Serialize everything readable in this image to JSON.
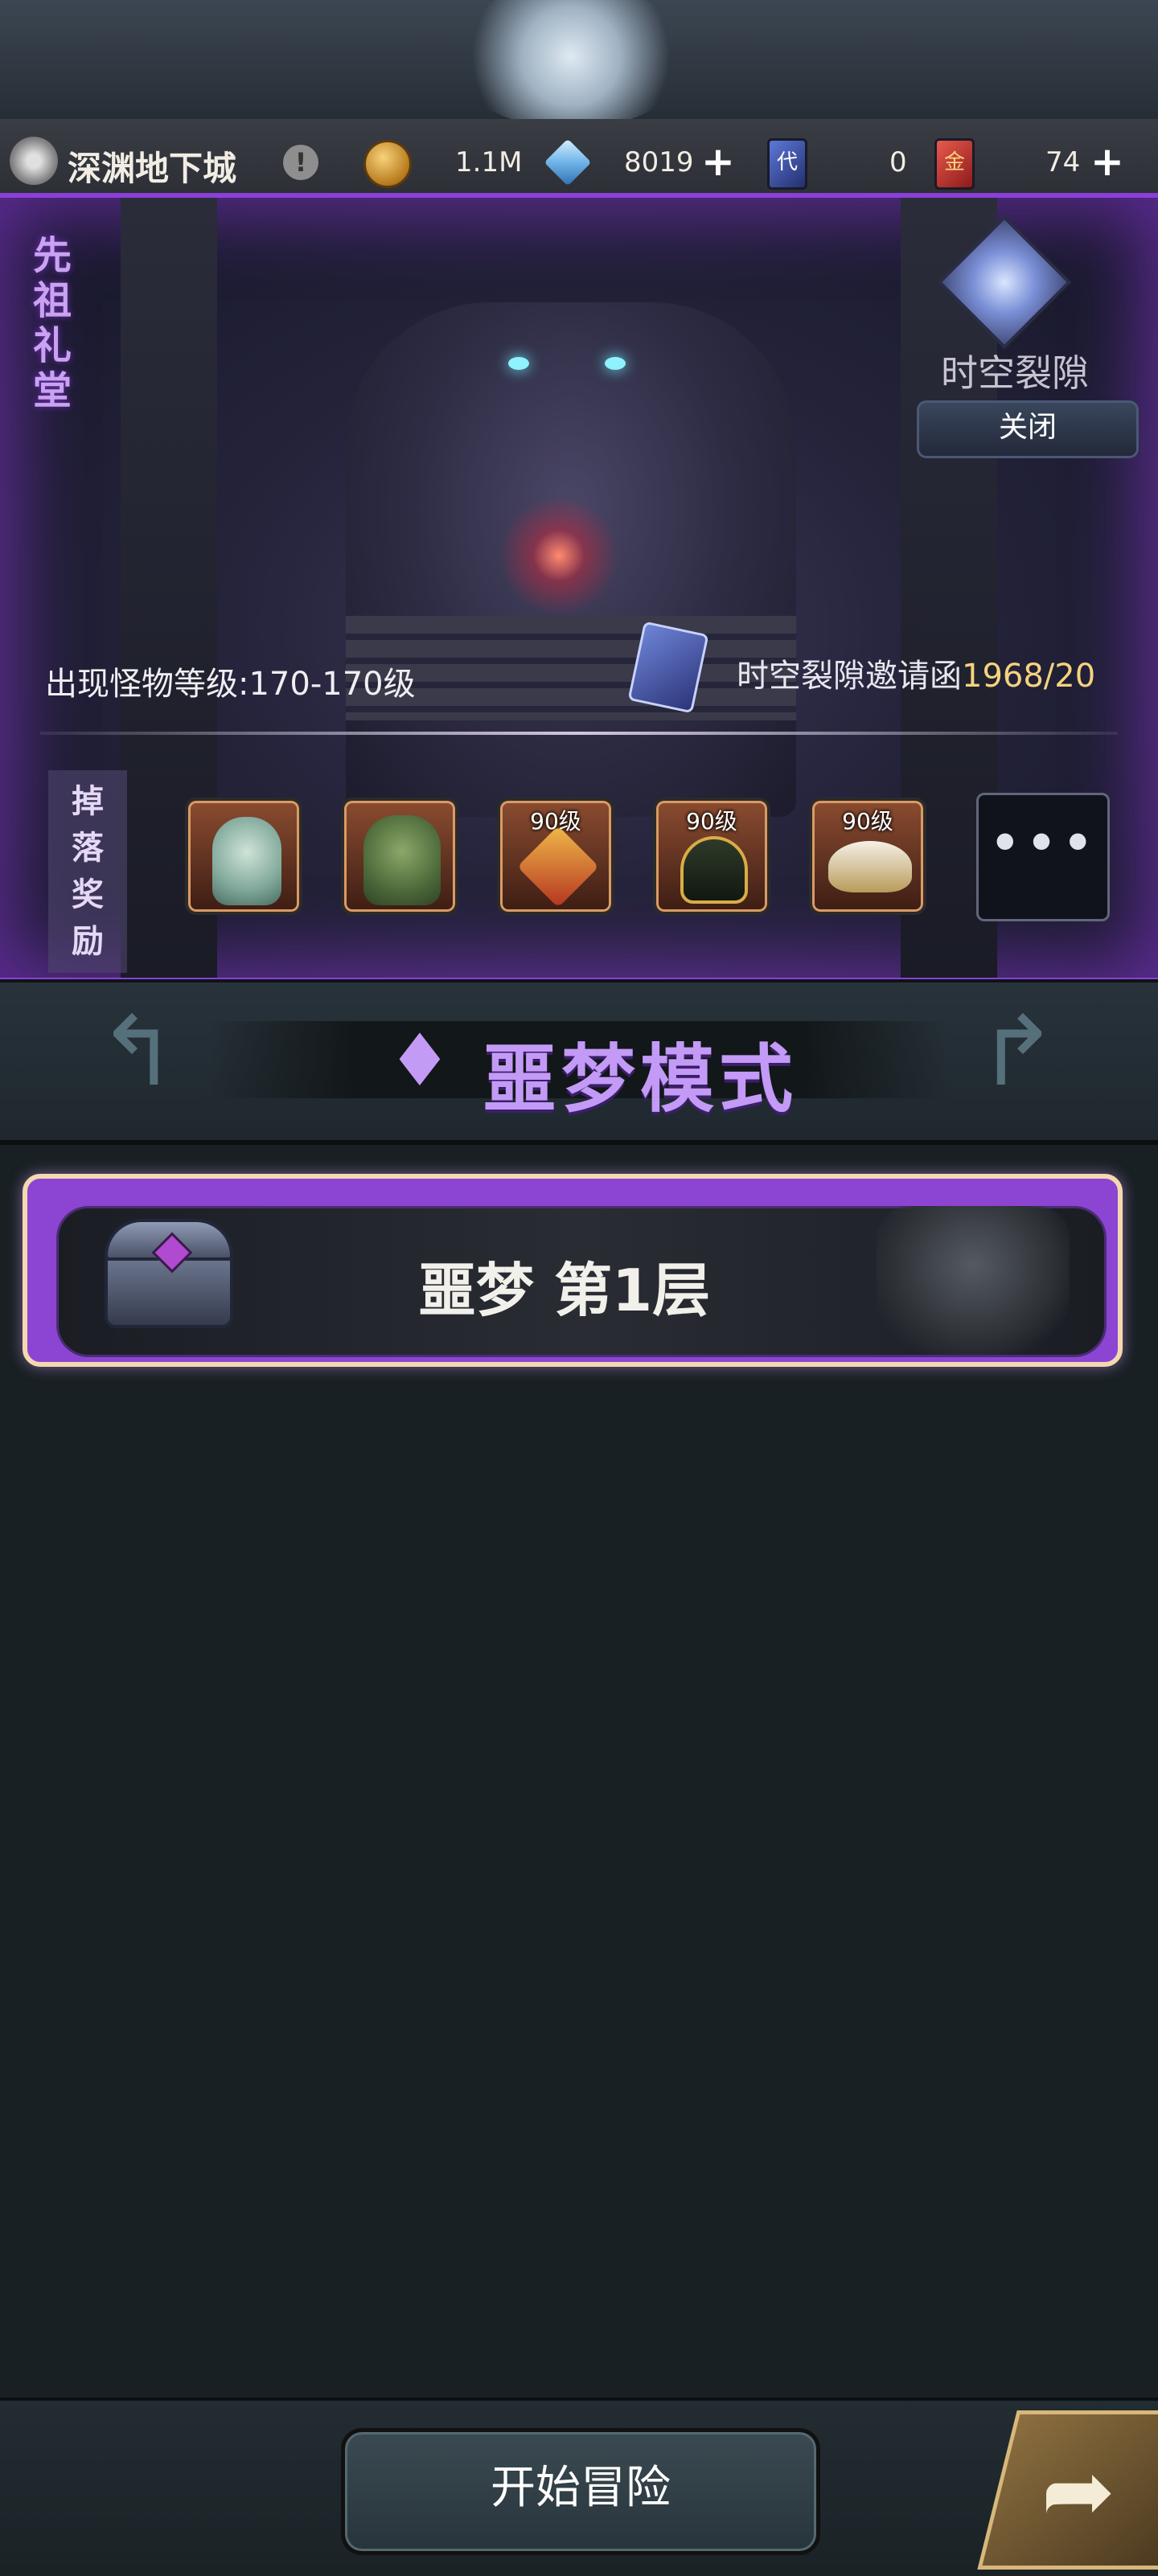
{
  "header": {
    "location_title": "深渊地下城",
    "gold_amount": "1.1M",
    "crystal_amount": "8019",
    "card_generic_amount": "0",
    "card_gold_amount": "74"
  },
  "banner": {
    "hall_title": "先祖礼堂",
    "rift_label": "时空裂隙",
    "close_label": "关闭",
    "monster_level": "出现怪物等级:170-170级",
    "invite_label": "时空裂隙邀请函",
    "invite_count": "1968/20",
    "drop_label": "掉落奖励",
    "drops": [
      {
        "level": ""
      },
      {
        "level": ""
      },
      {
        "level": "90级"
      },
      {
        "level": "90级"
      },
      {
        "level": "90级"
      }
    ],
    "more_label": "•••"
  },
  "mode": {
    "title": "噩梦模式"
  },
  "floor": {
    "label": "噩梦 第1层"
  },
  "footer": {
    "start_label": "开始冒险"
  },
  "colors": {
    "accent_purple": "#8a3fd6",
    "mode_title": "#c39af5",
    "invite_count": "#f5d37d"
  }
}
